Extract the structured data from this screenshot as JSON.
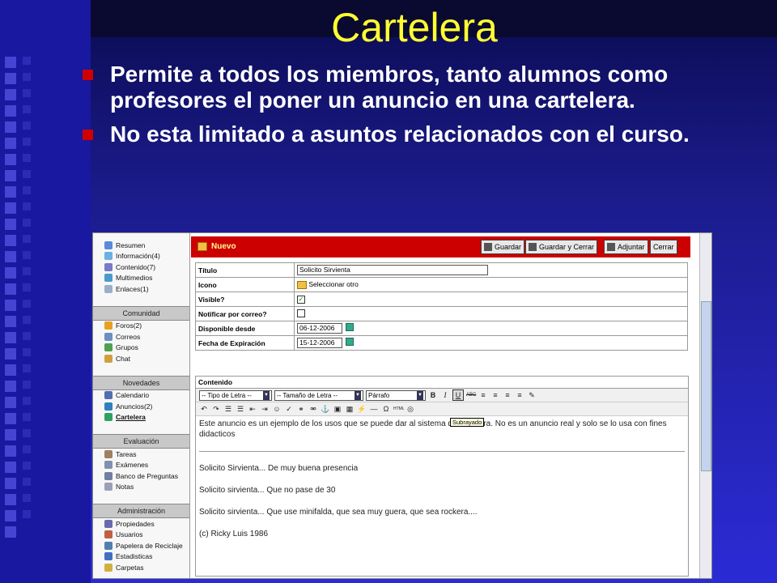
{
  "slide": {
    "title": "Cartelera",
    "bullets": [
      "Permite a todos los miembros, tanto alumnos como profesores el poner un anuncio en una cartelera.",
      "No esta limitado a asuntos relacionados con el curso."
    ]
  },
  "sidebar": {
    "group0": [
      "Resumen",
      "Información(4)",
      "Contenido(7)",
      "Multimedios",
      "Enlaces(1)"
    ],
    "comunidad_title": "Comunidad",
    "comunidad": [
      "Foros(2)",
      "Correos",
      "Grupos",
      "Chat"
    ],
    "novedades_title": "Novedades",
    "novedades": [
      "Calendario",
      "Anuncios(2)",
      "Cartelera"
    ],
    "evaluacion_title": "Evaluación",
    "evaluacion": [
      "Tareas",
      "Exámenes",
      "Banco de Preguntas",
      "Notas"
    ],
    "administracion_title": "Administración",
    "administracion": [
      "Propiedades",
      "Usuarios",
      "Papelera de Reciclaje",
      "Estadisticas",
      "Carpetas"
    ]
  },
  "header": {
    "nuevo": "Nuevo",
    "guardar": "Guardar",
    "guardar_cerrar": "Guardar y Cerrar",
    "adjuntar": "Adjuntar",
    "cerrar": "Cerrar"
  },
  "form": {
    "titulo_label": "Título",
    "titulo_value": "Solicito Sirvienta",
    "icono_label": "Icono",
    "icono_value": "Seleccionar otro",
    "visible_label": "Visible?",
    "notificar_label": "Notificar por correo?",
    "desde_label": "Disponible desde",
    "desde_value": "06-12-2006",
    "expiracion_label": "Fecha de Expiración",
    "expiracion_value": "15-12-2006"
  },
  "editor": {
    "label": "Contenido",
    "font_type": "-- Tipo de Letra --",
    "font_size": "-- Tamaño de Letra --",
    "paragraph": "Párrafo",
    "tooltip": "Subrayado",
    "intro": "Este anuncio es un ejemplo de los usos que se puede dar al sistema de cartelera. No es un anuncio real y solo se lo usa con fines didacticos",
    "line1": "Solicito Sirvienta... De muy buena presencia",
    "line2": "Solicito sirvienta... Que no pase de 30",
    "line3": "Solicito sirvienta... Que use minifalda, que sea muy guera, que sea rockera....",
    "signature": "(c) Ricky Luis 1986"
  }
}
